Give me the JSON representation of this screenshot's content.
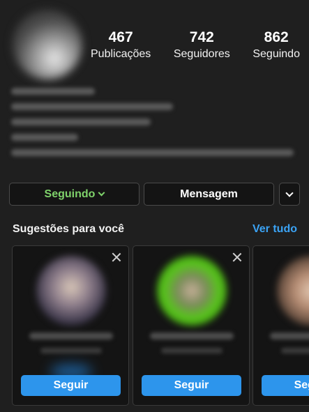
{
  "profile": {
    "stats": [
      {
        "value": "467",
        "label": "Publicações"
      },
      {
        "value": "742",
        "label": "Seguidores"
      },
      {
        "value": "862",
        "label": "Seguindo"
      }
    ]
  },
  "actions": {
    "following_label": "Seguindo",
    "message_label": "Mensagem"
  },
  "suggestions": {
    "title": "Sugestões para você",
    "see_all": "Ver tudo",
    "cards": [
      {
        "button_label": "Seguir"
      },
      {
        "button_label": "Seguir"
      },
      {
        "button_label": "Seguir"
      }
    ]
  },
  "colors": {
    "background": "#1f1f1f",
    "following_green": "#7fd36b",
    "link_blue": "#3ba3f5",
    "button_blue": "#2d95ec"
  }
}
